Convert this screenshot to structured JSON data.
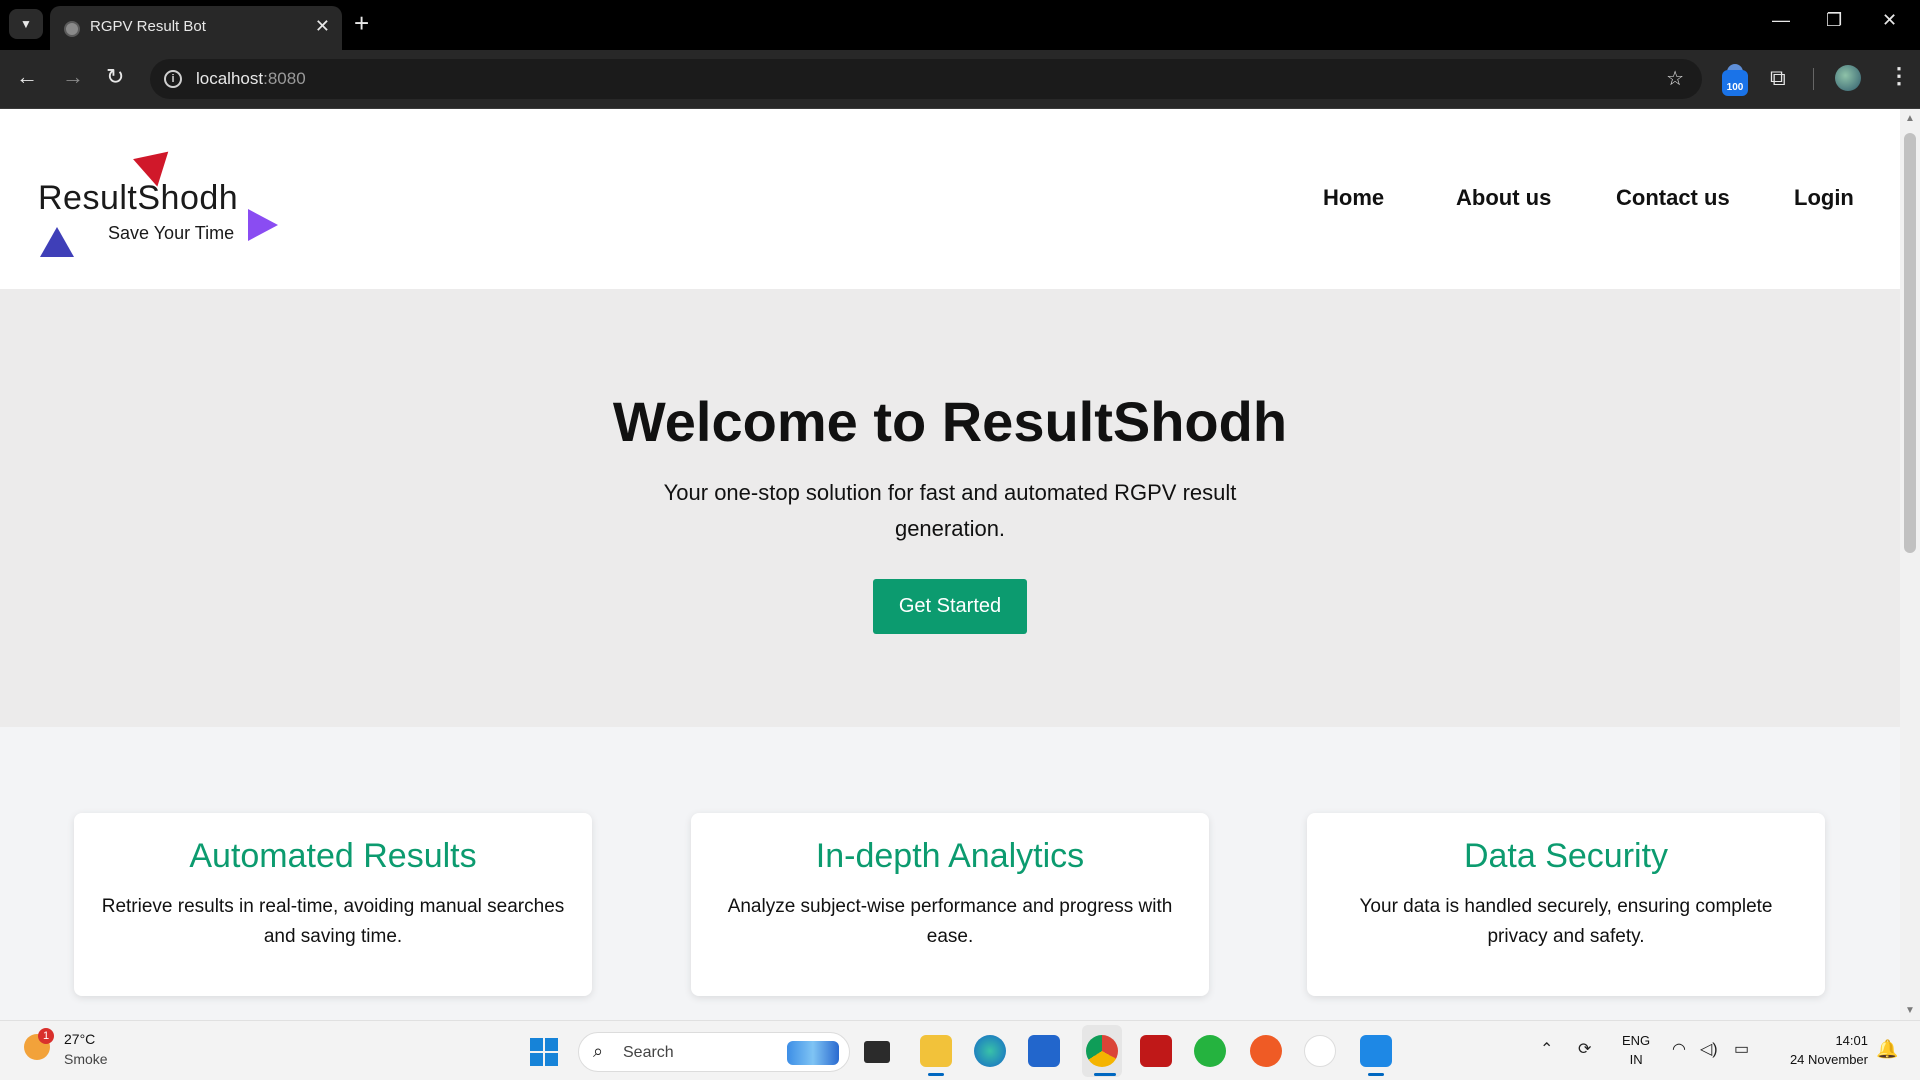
{
  "browser": {
    "tab_title": "RGPV Result Bot",
    "url_host": "localhost",
    "url_port": ":8080",
    "extension_badge": "100"
  },
  "site": {
    "logo": {
      "name": "ResultShodh",
      "tagline": "Save Your Time"
    },
    "nav": [
      "Home",
      "About us",
      "Contact us",
      "Login"
    ],
    "hero": {
      "title": "Welcome to ResultShodh",
      "subtitle": "Your one-stop solution for fast and automated RGPV result generation.",
      "cta": "Get Started"
    },
    "features": [
      {
        "title": "Automated Results",
        "text": "Retrieve results in real-time, avoiding manual searches and saving time."
      },
      {
        "title": "In-depth Analytics",
        "text": "Analyze subject-wise performance and progress with ease."
      },
      {
        "title": "Data Security",
        "text": "Your data is handled securely, ensuring complete privacy and safety."
      }
    ],
    "accent_color": "#0c9b6f"
  },
  "taskbar": {
    "weather": {
      "badge": "1",
      "temp": "27°C",
      "desc": "Smoke"
    },
    "search_placeholder": "Search",
    "language": {
      "line1": "ENG",
      "line2": "IN"
    },
    "clock": {
      "time": "14:01",
      "date": "24 November"
    },
    "apps": [
      "task-view",
      "file-explorer",
      "edge",
      "store",
      "chrome",
      "mcafee",
      "whatsapp",
      "postman",
      "mongodb-compass",
      "vscode"
    ]
  }
}
